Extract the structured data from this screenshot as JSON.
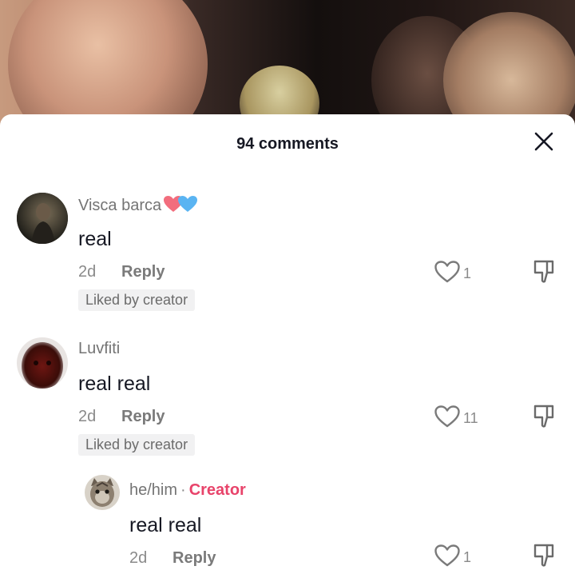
{
  "header": {
    "count_label": "94 comments"
  },
  "comments": [
    {
      "username": "Visca barca",
      "username_emoji": [
        "red-heart-icon",
        "blue-heart-icon"
      ],
      "text": "real",
      "age": "2d",
      "reply_label": "Reply",
      "badge": "Liked by creator",
      "likes": "1"
    },
    {
      "username": "Luvfiti",
      "text": "real real",
      "age": "2d",
      "reply_label": "Reply",
      "badge": "Liked by creator",
      "likes": "11"
    }
  ],
  "reply": {
    "username": "he/him",
    "separator": "·",
    "creator_label": "Creator",
    "text": "real real",
    "age": "2d",
    "reply_label": "Reply",
    "likes": "1"
  },
  "colors": {
    "creator": "#e8436a",
    "heart_red": "#f26d7d",
    "heart_blue": "#5ab4f2"
  }
}
